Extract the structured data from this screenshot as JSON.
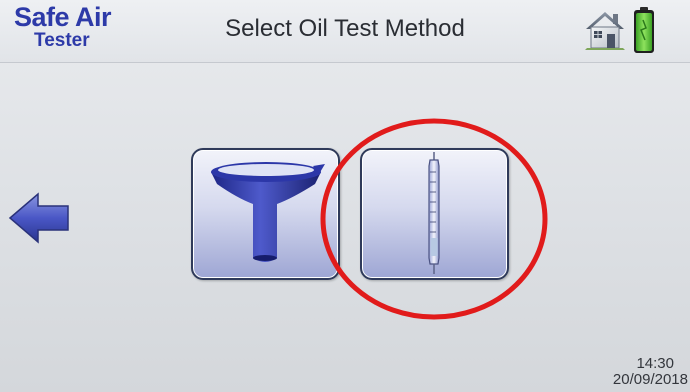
{
  "header": {
    "logo_line1": "Safe Air",
    "logo_line2": "Tester",
    "title": "Select Oil Test Method",
    "home_icon": "home-icon",
    "battery_icon": "battery-icon"
  },
  "navigation": {
    "back_icon": "arrow-left-icon"
  },
  "options": [
    {
      "icon": "funnel-icon",
      "selected": false
    },
    {
      "icon": "detector-tube-icon",
      "selected": true
    }
  ],
  "status": {
    "time": "14:30",
    "date": "20/09/2018"
  },
  "colors": {
    "brand": "#2d3aa8",
    "icon_blue": "#2f3aa7",
    "highlight": "#e11b1b",
    "battery": "#5fcf37"
  }
}
